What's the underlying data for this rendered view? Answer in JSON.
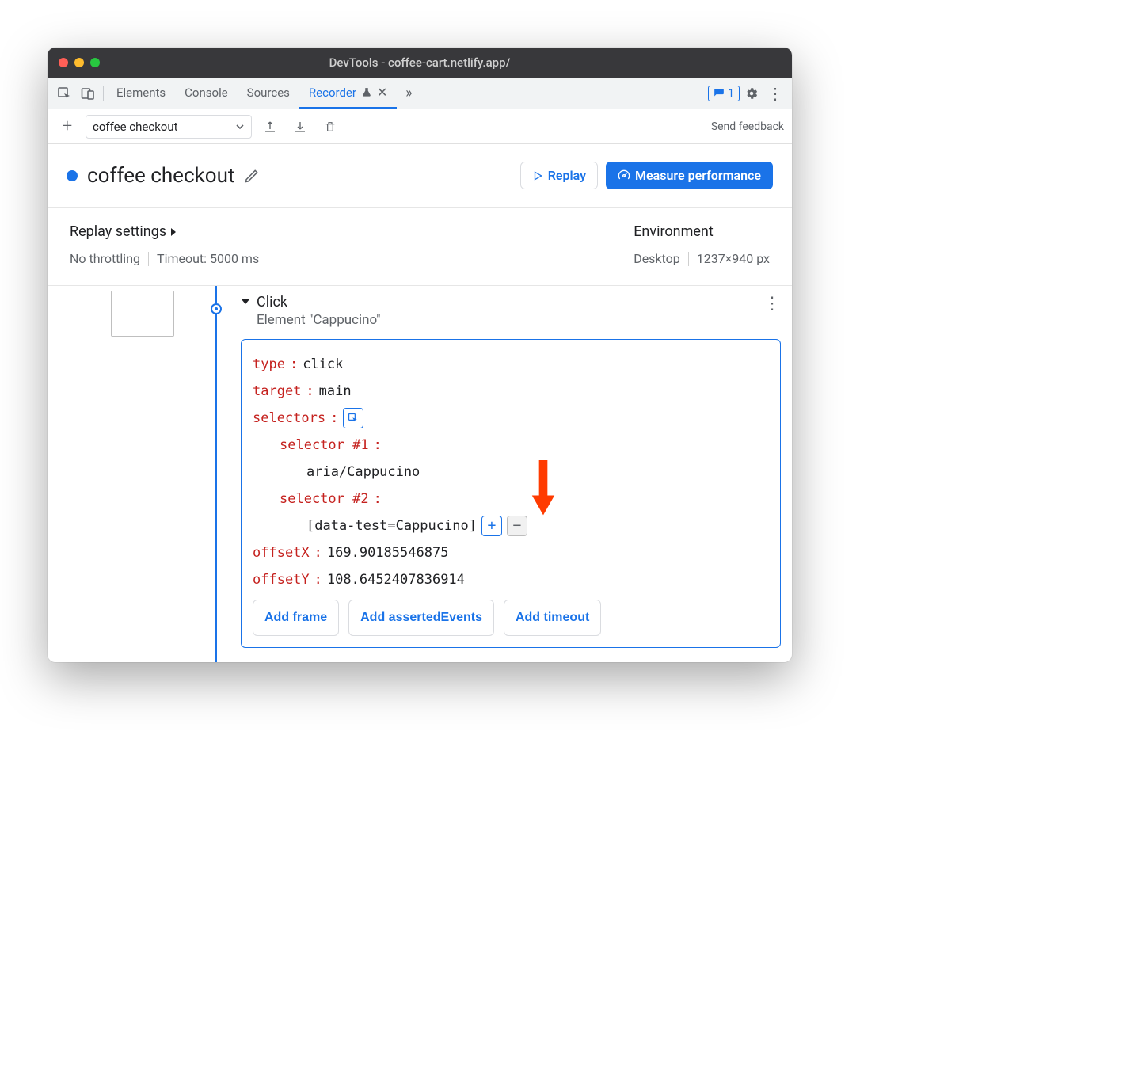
{
  "window": {
    "title": "DevTools - coffee-cart.netlify.app/"
  },
  "tabs": {
    "items": [
      "Elements",
      "Console",
      "Sources",
      "Recorder"
    ],
    "active": "Recorder",
    "issues_count": "1"
  },
  "recorder_toolbar": {
    "selected_recording": "coffee checkout",
    "feedback_link": "Send feedback"
  },
  "recording": {
    "name": "coffee checkout",
    "replay_label": "Replay",
    "measure_label": "Measure performance"
  },
  "settings": {
    "replay_heading": "Replay settings",
    "throttling": "No throttling",
    "timeout": "Timeout: 5000 ms",
    "env_heading": "Environment",
    "device": "Desktop",
    "viewport": "1237×940 px"
  },
  "step": {
    "title": "Click",
    "subtitle": "Element \"Cappucino\"",
    "fields": {
      "type_key": "type",
      "type_val": "click",
      "target_key": "target",
      "target_val": "main",
      "selectors_key": "selectors",
      "sel1_key": "selector #1",
      "sel1_val": "aria/Cappucino",
      "sel2_key": "selector #2",
      "sel2_val": "[data-test=Cappucino]",
      "offx_key": "offsetX",
      "offx_val": "169.90185546875",
      "offy_key": "offsetY",
      "offy_val": "108.6452407836914"
    },
    "chips": {
      "frame": "Add frame",
      "asserted": "Add assertedEvents",
      "timeout": "Add timeout"
    }
  }
}
